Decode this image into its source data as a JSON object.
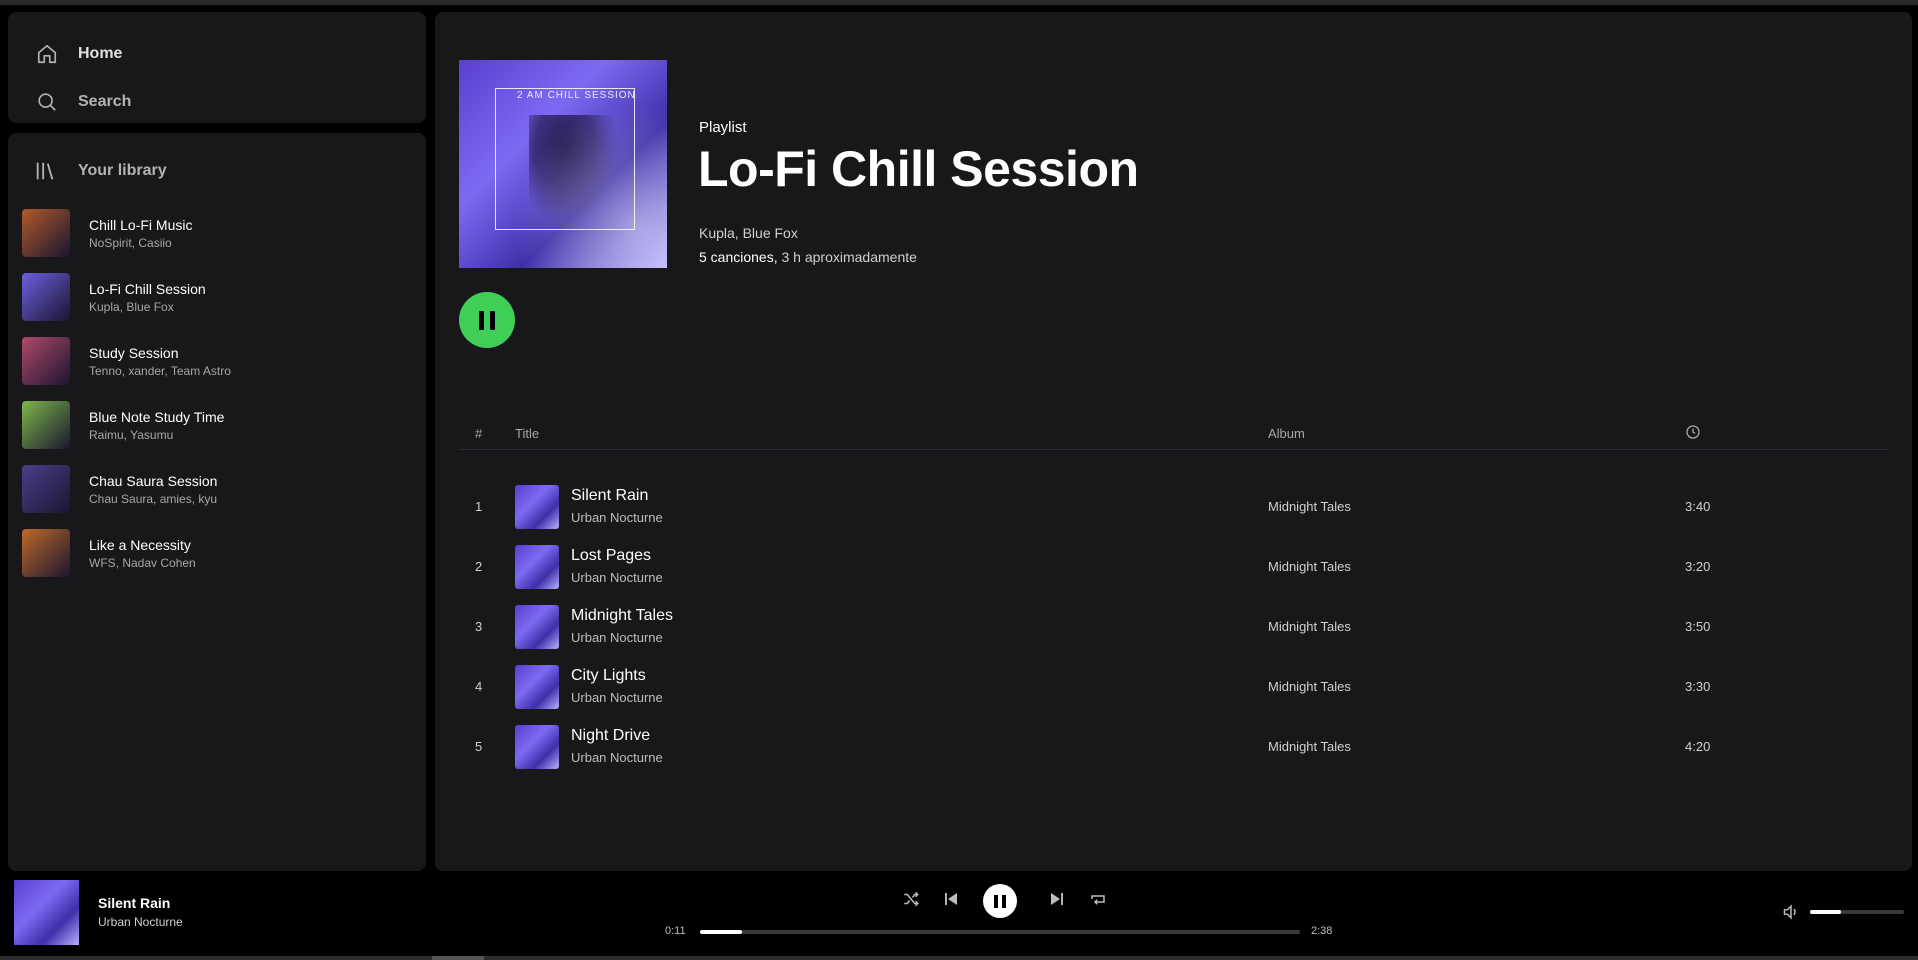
{
  "nav": {
    "home_label": "Home",
    "home_icon": "home-icon",
    "search_label": "Search",
    "search_icon": "search-icon"
  },
  "library": {
    "title": "Your library",
    "icon": "library-icon",
    "items": [
      {
        "title": "Chill Lo-Fi Music",
        "subtitle": "NoSpirit, Casiio",
        "color": "#b05a2a"
      },
      {
        "title": "Lo-Fi Chill Session",
        "subtitle": "Kupla, Blue Fox",
        "color": "#6e5fe0"
      },
      {
        "title": "Study Session",
        "subtitle": "Tenno, xander, Team Astro",
        "color": "#b04a6a"
      },
      {
        "title": "Blue Note Study Time",
        "subtitle": "Raimu, Yasumu",
        "color": "#7fb84a"
      },
      {
        "title": "Chau Saura Session",
        "subtitle": "Chau Saura, amies, kyu",
        "color": "#4a3f8a"
      },
      {
        "title": "Like a Necessity",
        "subtitle": "WFS, Nadav Cohen",
        "color": "#c06a2a"
      }
    ]
  },
  "playlist": {
    "type": "Playlist",
    "title": "Lo-Fi Chill Session",
    "artists": "Kupla, Blue Fox",
    "count": "5 canciones,",
    "duration": " 3 h aproximadamente",
    "cover_text": "2 AM CHILL SESSION"
  },
  "table": {
    "num_header": "#",
    "title_header": "Title",
    "album_header": "Album",
    "duration_icon": "clock-icon",
    "rows": [
      {
        "num": "1",
        "title": "Silent Rain",
        "artist": "Urban Nocturne",
        "album": "Midnight Tales",
        "duration": "3:40"
      },
      {
        "num": "2",
        "title": "Lost Pages",
        "artist": "Urban Nocturne",
        "album": "Midnight Tales",
        "duration": "3:20"
      },
      {
        "num": "3",
        "title": "Midnight Tales",
        "artist": "Urban Nocturne",
        "album": "Midnight Tales",
        "duration": "3:50"
      },
      {
        "num": "4",
        "title": "City Lights",
        "artist": "Urban Nocturne",
        "album": "Midnight Tales",
        "duration": "3:30"
      },
      {
        "num": "5",
        "title": "Night Drive",
        "artist": "Urban Nocturne",
        "album": "Midnight Tales",
        "duration": "4:20"
      }
    ]
  },
  "player": {
    "title": "Silent Rain",
    "artist": "Urban Nocturne",
    "current_time": "0:11",
    "total_time": "2:38",
    "progress": 0.07,
    "volume": 0.33,
    "icons": [
      "shuffle-icon",
      "previous-icon",
      "pause-icon",
      "next-icon",
      "repeat-icon",
      "volume-icon"
    ]
  },
  "colors": {
    "accent": "#3fcf56",
    "panel": "#18181b",
    "background": "#000000"
  }
}
